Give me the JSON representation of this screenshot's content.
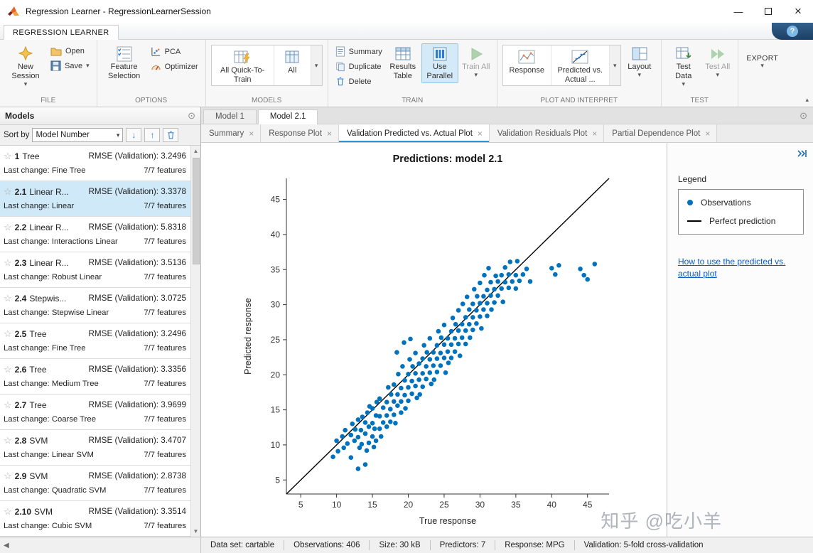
{
  "window": {
    "title": "Regression Learner - RegressionLearnerSession"
  },
  "icons": {
    "dropdown": "▾",
    "close": "×",
    "minimize": "—",
    "close_window": "×",
    "sort_desc": "↓",
    "sort_asc": "↑",
    "favorite": "☆",
    "round_toggle": "⊙",
    "panel_collapse": "◀",
    "scroll_up": "▲",
    "scroll_down": "▼",
    "ribbon_collapse": "▴"
  },
  "colors": {
    "scatter_blue": "#0072BD",
    "selection_blue": "#cfe9f8",
    "link_blue": "#0b5cc4",
    "tab_highlight": "#2e95d3"
  },
  "ribbon": {
    "tab_label": "REGRESSION LEARNER",
    "help_label": "?",
    "file": {
      "label": "FILE",
      "new_session": "New Session",
      "open": "Open",
      "save": "Save"
    },
    "options": {
      "label": "OPTIONS",
      "feature_selection": "Feature Selection",
      "pca": "PCA",
      "optimizer": "Optimizer"
    },
    "models": {
      "label": "MODELS",
      "all_quick": "All Quick-To-Train",
      "all": "All"
    },
    "train": {
      "label": "TRAIN",
      "summary": "Summary",
      "duplicate": "Duplicate",
      "delete": "Delete",
      "results_table": "Results Table",
      "use_parallel": "Use Parallel",
      "train_all": "Train All"
    },
    "plot": {
      "label": "PLOT AND INTERPRET",
      "response": "Response",
      "predicted_vs_actual": "Predicted vs. Actual ...",
      "layout": "Layout"
    },
    "test": {
      "label": "TEST",
      "test_data": "Test Data",
      "test_all": "Test All"
    },
    "export_section": {
      "button": "EXPORT"
    }
  },
  "models_panel": {
    "title": "Models",
    "sort_label": "Sort by",
    "sort_value": "Model Number",
    "metric_label": "RMSE (Validation):",
    "last_change_label": "Last change:",
    "items": [
      {
        "id": "1",
        "type": "Tree",
        "metric": "3.2496",
        "last_change": "Fine Tree",
        "features": "7/7 features",
        "selected": false
      },
      {
        "id": "2.1",
        "type": "Linear R...",
        "metric": "3.3378",
        "last_change": "Linear",
        "features": "7/7 features",
        "selected": true
      },
      {
        "id": "2.2",
        "type": "Linear R...",
        "metric": "5.8318",
        "last_change": "Interactions Linear",
        "features": "7/7 features",
        "selected": false
      },
      {
        "id": "2.3",
        "type": "Linear R...",
        "metric": "3.5136",
        "last_change": "Robust Linear",
        "features": "7/7 features",
        "selected": false
      },
      {
        "id": "2.4",
        "type": "Stepwis...",
        "metric": "3.0725",
        "last_change": "Stepwise Linear",
        "features": "7/7 features",
        "selected": false
      },
      {
        "id": "2.5",
        "type": "Tree",
        "metric": "3.2496",
        "last_change": "Fine Tree",
        "features": "7/7 features",
        "selected": false
      },
      {
        "id": "2.6",
        "type": "Tree",
        "metric": "3.3356",
        "last_change": "Medium Tree",
        "features": "7/7 features",
        "selected": false
      },
      {
        "id": "2.7",
        "type": "Tree",
        "metric": "3.9699",
        "last_change": "Coarse Tree",
        "features": "7/7 features",
        "selected": false
      },
      {
        "id": "2.8",
        "type": "SVM",
        "metric": "3.4707",
        "last_change": "Linear SVM",
        "features": "7/7 features",
        "selected": false
      },
      {
        "id": "2.9",
        "type": "SVM",
        "metric": "2.8738",
        "last_change": "Quadratic SVM",
        "features": "7/7 features",
        "selected": false
      },
      {
        "id": "2.10",
        "type": "SVM",
        "metric": "3.3514",
        "last_change": "Cubic SVM",
        "features": "7/7 features",
        "selected": false
      }
    ]
  },
  "document_tabs": [
    {
      "label": "Model 1",
      "active": false
    },
    {
      "label": "Model 2.1",
      "active": true
    }
  ],
  "figure_tabs": [
    {
      "label": "Summary",
      "active": false
    },
    {
      "label": "Response Plot",
      "active": false
    },
    {
      "label": "Validation Predicted vs. Actual Plot",
      "active": true
    },
    {
      "label": "Validation Residuals Plot",
      "active": false
    },
    {
      "label": "Partial Dependence Plot",
      "active": false
    }
  ],
  "legend": {
    "title": "Legend",
    "items": [
      {
        "label": "Observations"
      },
      {
        "label": "Perfect prediction"
      }
    ],
    "link": "How to use the predicted vs. actual plot"
  },
  "chart_data": {
    "type": "scatter",
    "title": "Predictions: model 2.1",
    "xlabel": "True response",
    "ylabel": "Predicted response",
    "xlim": [
      3,
      48
    ],
    "ylim": [
      3,
      48
    ],
    "xticks": [
      5,
      10,
      15,
      20,
      25,
      30,
      35,
      40,
      45
    ],
    "yticks": [
      5,
      10,
      15,
      20,
      25,
      30,
      35,
      40,
      45
    ],
    "grid": false,
    "legend_position": "right-panel",
    "series": [
      {
        "name": "Observations",
        "type": "scatter",
        "color": "#0072BD",
        "points": [
          [
            9.5,
            8.3
          ],
          [
            10,
            10.6
          ],
          [
            10.2,
            9.1
          ],
          [
            10.8,
            11.2
          ],
          [
            11,
            9.6
          ],
          [
            11.2,
            12.1
          ],
          [
            11.5,
            10.2
          ],
          [
            12,
            8.2
          ],
          [
            12,
            11.4
          ],
          [
            12.2,
            13
          ],
          [
            12.5,
            10.6
          ],
          [
            12.6,
            12.2
          ],
          [
            13,
            6.6
          ],
          [
            13,
            11.1
          ],
          [
            13,
            13.6
          ],
          [
            13.2,
            9.6
          ],
          [
            13.4,
            12.1
          ],
          [
            13.5,
            10.1
          ],
          [
            13.6,
            14
          ],
          [
            14,
            7.2
          ],
          [
            14,
            11.6
          ],
          [
            14,
            13.2
          ],
          [
            14.2,
            9.2
          ],
          [
            14.3,
            14.6
          ],
          [
            14.5,
            10.3
          ],
          [
            14.5,
            12.6
          ],
          [
            14.6,
            15.5
          ],
          [
            15,
            11.2
          ],
          [
            15,
            13.1
          ],
          [
            15,
            15.2
          ],
          [
            15.2,
            9.7
          ],
          [
            15.3,
            12.3
          ],
          [
            15.5,
            14.2
          ],
          [
            15.5,
            10.6
          ],
          [
            15.6,
            16.1
          ],
          [
            16,
            12.3
          ],
          [
            16,
            14.1
          ],
          [
            16,
            16.6
          ],
          [
            16.2,
            11.2
          ],
          [
            16.5,
            13.2
          ],
          [
            16.5,
            15.3
          ],
          [
            17,
            14.2
          ],
          [
            17,
            16.1
          ],
          [
            17,
            12.6
          ],
          [
            17.2,
            18.2
          ],
          [
            17.5,
            15.1
          ],
          [
            17.5,
            13.3
          ],
          [
            17.6,
            17.2
          ],
          [
            18,
            14.3
          ],
          [
            18,
            16.2
          ],
          [
            18,
            18.6
          ],
          [
            18.2,
            13.1
          ],
          [
            18.4,
            23.2
          ],
          [
            18.5,
            15.6
          ],
          [
            18.5,
            17.2
          ],
          [
            18.6,
            20.1
          ],
          [
            19,
            16.2
          ],
          [
            19,
            18.1
          ],
          [
            19,
            14.6
          ],
          [
            19.2,
            21.2
          ],
          [
            19.4,
            24.6
          ],
          [
            19.5,
            17.1
          ],
          [
            19.5,
            19.2
          ],
          [
            19.6,
            15.2
          ],
          [
            20,
            18.2
          ],
          [
            20,
            20.1
          ],
          [
            20,
            16.3
          ],
          [
            20.2,
            22.2
          ],
          [
            20.3,
            25.1
          ],
          [
            20.5,
            19.1
          ],
          [
            20.5,
            17.3
          ],
          [
            20.6,
            21.2
          ],
          [
            21,
            18.4
          ],
          [
            21,
            20.2
          ],
          [
            21,
            23.1
          ],
          [
            21.2,
            16.7
          ],
          [
            21.5,
            19.3
          ],
          [
            21.5,
            21.6
          ],
          [
            21.6,
            17.2
          ],
          [
            22,
            20.2
          ],
          [
            22,
            22.3
          ],
          [
            22,
            18.3
          ],
          [
            22.2,
            24.2
          ],
          [
            22.5,
            21.2
          ],
          [
            22.5,
            19.4
          ],
          [
            22.6,
            23.2
          ],
          [
            23,
            20.3
          ],
          [
            23,
            22.2
          ],
          [
            23,
            25.2
          ],
          [
            23.2,
            18.7
          ],
          [
            23.5,
            21.3
          ],
          [
            23.5,
            23.2
          ],
          [
            23.6,
            19.3
          ],
          [
            24,
            22.3
          ],
          [
            24,
            24.2
          ],
          [
            24,
            20.4
          ],
          [
            24.2,
            26.2
          ],
          [
            24.5,
            23.1
          ],
          [
            24.5,
            21.3
          ],
          [
            24.6,
            25.3
          ],
          [
            25,
            22.4
          ],
          [
            25,
            24.3
          ],
          [
            25,
            27.1
          ],
          [
            25.2,
            20.3
          ],
          [
            25.5,
            23.3
          ],
          [
            25.5,
            25.2
          ],
          [
            25.6,
            21.7
          ],
          [
            26,
            24.3
          ],
          [
            26,
            26.2
          ],
          [
            26,
            22.4
          ],
          [
            26.2,
            28.1
          ],
          [
            26.5,
            25.2
          ],
          [
            26.5,
            23.3
          ],
          [
            26.6,
            27.2
          ],
          [
            27,
            24.4
          ],
          [
            27,
            26.3
          ],
          [
            27,
            29.2
          ],
          [
            27.2,
            22.7
          ],
          [
            27.5,
            25.3
          ],
          [
            27.5,
            27.2
          ],
          [
            27.6,
            30.1
          ],
          [
            28,
            26.3
          ],
          [
            28,
            28.2
          ],
          [
            28,
            24.4
          ],
          [
            28.2,
            31.1
          ],
          [
            28.5,
            27.2
          ],
          [
            28.5,
            29.3
          ],
          [
            28.6,
            25.3
          ],
          [
            29,
            28.2
          ],
          [
            29,
            30.1
          ],
          [
            29,
            26.4
          ],
          [
            29.2,
            32.2
          ],
          [
            29.5,
            29.2
          ],
          [
            29.5,
            27.3
          ],
          [
            29.6,
            31.2
          ],
          [
            30,
            28.3
          ],
          [
            30,
            30.2
          ],
          [
            30,
            33.1
          ],
          [
            30.2,
            26.6
          ],
          [
            30.5,
            29.3
          ],
          [
            30.5,
            31.2
          ],
          [
            30.6,
            34.2
          ],
          [
            31,
            30.2
          ],
          [
            31,
            32.1
          ],
          [
            31,
            28.4
          ],
          [
            31.2,
            35.2
          ],
          [
            31.5,
            31.3
          ],
          [
            31.5,
            33.2
          ],
          [
            31.6,
            29.3
          ],
          [
            32,
            32.2
          ],
          [
            32,
            30.3
          ],
          [
            32.2,
            34.1
          ],
          [
            32.5,
            31.3
          ],
          [
            32.5,
            33.3
          ],
          [
            33,
            32.3
          ],
          [
            33,
            34.2
          ],
          [
            33.2,
            30.4
          ],
          [
            33.5,
            33.2
          ],
          [
            33.5,
            35.3
          ],
          [
            34,
            32.4
          ],
          [
            34,
            34.3
          ],
          [
            34.2,
            36.1
          ],
          [
            34.5,
            33.3
          ],
          [
            35,
            34.2
          ],
          [
            35,
            32.3
          ],
          [
            35.2,
            36.2
          ],
          [
            35.5,
            33.4
          ],
          [
            36,
            34.3
          ],
          [
            36.5,
            35.1
          ],
          [
            37,
            33.3
          ],
          [
            40,
            35.2
          ],
          [
            40.5,
            34.3
          ],
          [
            41,
            35.6
          ],
          [
            44,
            35.1
          ],
          [
            44.5,
            34.2
          ],
          [
            45,
            33.6
          ],
          [
            46,
            35.8
          ]
        ]
      },
      {
        "name": "Perfect prediction",
        "type": "line",
        "color": "#000000",
        "points": [
          [
            3,
            3
          ],
          [
            48,
            48
          ]
        ]
      }
    ]
  },
  "status_bar": {
    "items": [
      "Data set: cartable",
      "Observations: 406",
      "Size: 30 kB",
      "Predictors: 7",
      "Response: MPG",
      "Validation: 5-fold cross-validation"
    ]
  },
  "watermark": "知乎 @吃小羊"
}
